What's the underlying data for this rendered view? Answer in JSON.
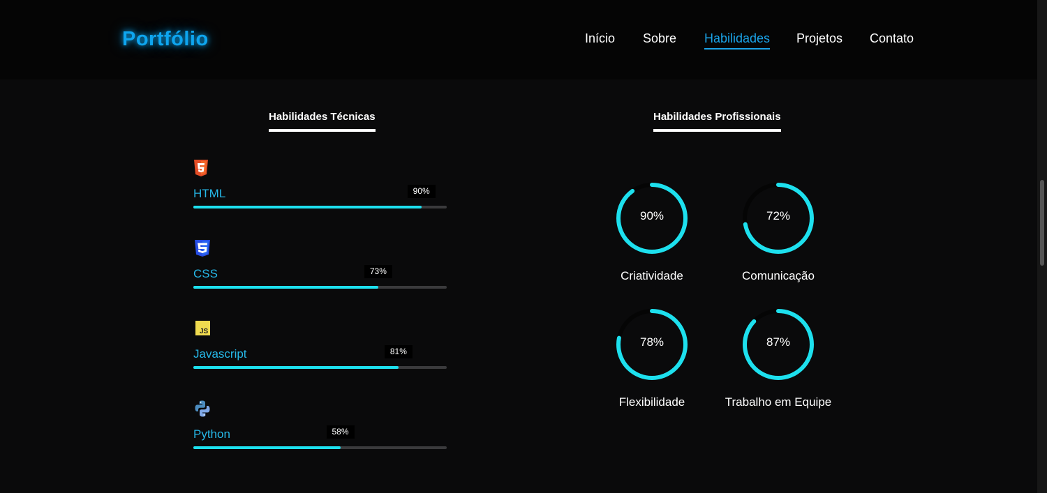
{
  "header": {
    "logo": "Portfólio",
    "nav": [
      {
        "label": "Início"
      },
      {
        "label": "Sobre"
      },
      {
        "label": "Habilidades",
        "active": true
      },
      {
        "label": "Projetos"
      },
      {
        "label": "Contato"
      }
    ]
  },
  "technical": {
    "title": "Habilidades Técnicas",
    "skills": [
      {
        "name": "HTML",
        "percent": 90,
        "percent_label": "90%",
        "icon": "html5-icon",
        "color": "#e44d26"
      },
      {
        "name": "CSS",
        "percent": 73,
        "percent_label": "73%",
        "icon": "css3-icon",
        "color": "#264de4"
      },
      {
        "name": "Javascript",
        "percent": 81,
        "percent_label": "81%",
        "icon": "javascript-icon",
        "color": "#f0db4f"
      },
      {
        "name": "Python",
        "percent": 58,
        "percent_label": "58%",
        "icon": "python-icon",
        "color": "#4b8bbe"
      }
    ]
  },
  "professional": {
    "title": "Habilidades Profissionais",
    "skills": [
      {
        "name": "Criatividade",
        "percent": 90,
        "percent_label": "90%"
      },
      {
        "name": "Comunicação",
        "percent": 72,
        "percent_label": "72%"
      },
      {
        "name": "Flexibilidade",
        "percent": 78,
        "percent_label": "78%"
      },
      {
        "name": "Trabalho em Equipe",
        "percent": 87,
        "percent_label": "87%"
      }
    ]
  },
  "colors": {
    "accent": "#1de0ee",
    "logo": "#0ea5ef",
    "link_active": "#1aa3e8",
    "skill_name": "#26b8e8"
  }
}
